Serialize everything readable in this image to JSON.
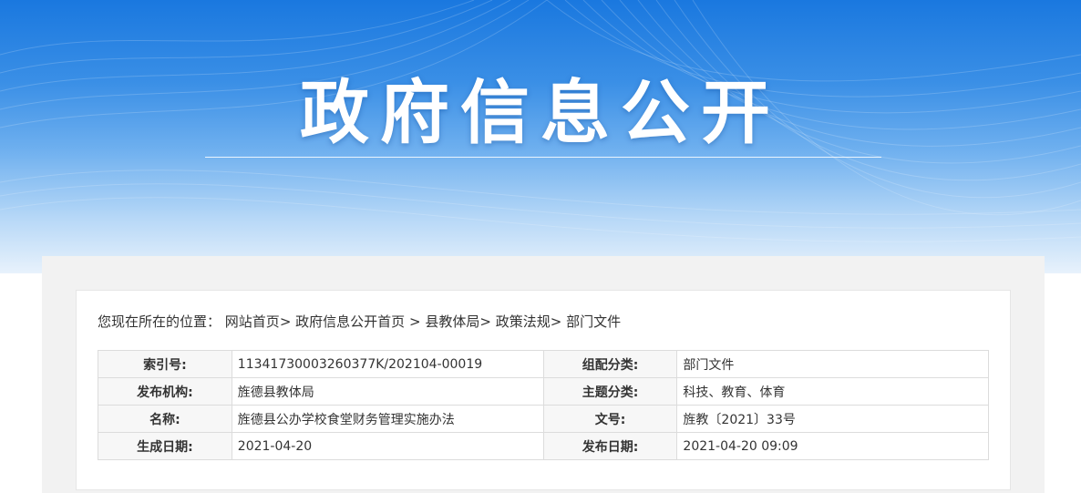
{
  "banner": {
    "title": "政府信息公开"
  },
  "breadcrumb": {
    "prefix": "您现在所在的位置：",
    "items": [
      {
        "label": "网站首页",
        "sep": ">"
      },
      {
        "label": "政府信息公开首页",
        "sep": " >"
      },
      {
        "label": "县教体局",
        "sep": ">"
      },
      {
        "label": "政策法规",
        "sep": ">"
      },
      {
        "label": "部门文件",
        "sep": ""
      }
    ]
  },
  "meta": {
    "rows": [
      {
        "label1": "索引号:",
        "value1": "11341730003260377K/202104-00019",
        "label2": "组配分类:",
        "value2": "部门文件"
      },
      {
        "label1": "发布机构:",
        "value1": "旌德县教体局",
        "label2": "主题分类:",
        "value2": "科技、教育、体育"
      },
      {
        "label1": "名称:",
        "value1": "旌德县公办学校食堂财务管理实施办法",
        "label2": "文号:",
        "value2": "旌教〔2021〕33号"
      },
      {
        "label1": "生成日期:",
        "value1": "2021-04-20",
        "label2": "发布日期:",
        "value2": "2021-04-20 09:09"
      }
    ]
  },
  "colors": {
    "banner_top": "#1a78df",
    "banner_bottom": "#e8f2fc",
    "panel_bg": "#f2f2f2",
    "text": "#333333",
    "border": "#dcdcdc"
  }
}
